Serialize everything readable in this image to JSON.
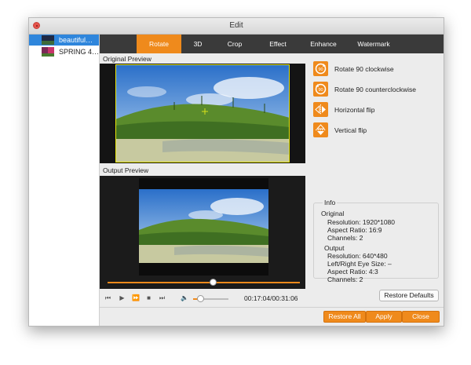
{
  "window": {
    "title": "Edit"
  },
  "sidebar": {
    "items": [
      {
        "label": "beautiful…",
        "selected": true
      },
      {
        "label": "SPRING 4…",
        "selected": false
      }
    ]
  },
  "tabs": [
    {
      "label": "Rotate",
      "active": true
    },
    {
      "label": "3D",
      "active": false
    },
    {
      "label": "Crop",
      "active": false
    },
    {
      "label": "Effect",
      "active": false
    },
    {
      "label": "Enhance",
      "active": false
    },
    {
      "label": "Watermark",
      "active": false
    }
  ],
  "preview": {
    "original_label": "Original Preview",
    "output_label": "Output Preview"
  },
  "player": {
    "timecode": "00:17:04/00:31:06",
    "seek_fraction": 0.55,
    "volume_fraction": 0.2
  },
  "rotate_actions": [
    {
      "label": "Rotate 90 clockwise",
      "icon": "rotate-cw-icon",
      "glyph": "90"
    },
    {
      "label": "Rotate 90 counterclockwise",
      "icon": "rotate-ccw-icon",
      "glyph": "90"
    },
    {
      "label": "Horizontal flip",
      "icon": "flip-horizontal-icon",
      "glyph": "⇹"
    },
    {
      "label": "Vertical flip",
      "icon": "flip-vertical-icon",
      "glyph": "⇳"
    }
  ],
  "info": {
    "legend": "Info",
    "original_heading": "Original",
    "original_lines": [
      "Resolution: 1920*1080",
      "Aspect Ratio: 16:9",
      "Channels: 2"
    ],
    "output_heading": "Output",
    "output_lines": [
      "Resolution: 640*480",
      "Left/Right Eye Size: –",
      "Aspect Ratio: 4:3",
      "Channels: 2"
    ]
  },
  "buttons": {
    "restore_defaults": "Restore Defaults",
    "restore_all": "Restore All",
    "apply": "Apply",
    "close": "Close"
  },
  "colors": {
    "accent": "#ef8a1c",
    "selection": "#2f86dc",
    "tabbar": "#3a3a3a",
    "crop_box": "#e8e60a"
  }
}
